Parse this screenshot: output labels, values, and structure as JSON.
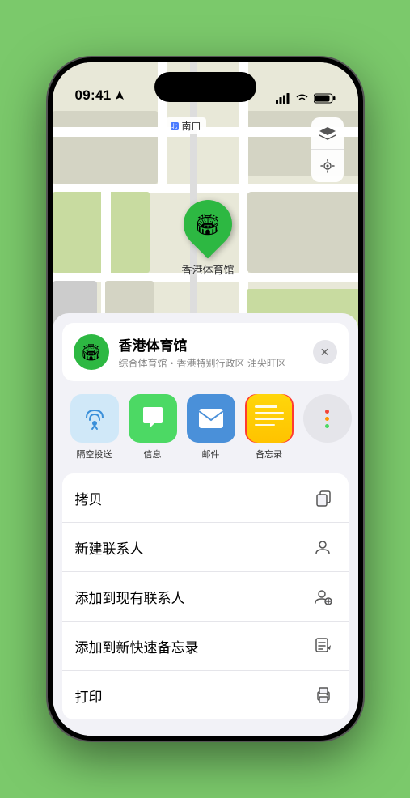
{
  "status_bar": {
    "time": "09:41",
    "location_arrow": "▶"
  },
  "map": {
    "label_text": "南口",
    "controls": [
      "map-layers",
      "location"
    ]
  },
  "marker": {
    "name": "香港体育馆",
    "icon": "🏟"
  },
  "location_card": {
    "name": "香港体育馆",
    "subtitle": "综合体育馆・香港特别行政区 油尖旺区",
    "close_label": "✕"
  },
  "share_items": [
    {
      "id": "airdrop",
      "label": "隔空投送",
      "highlighted": false
    },
    {
      "id": "messages",
      "label": "信息",
      "highlighted": false
    },
    {
      "id": "mail",
      "label": "邮件",
      "highlighted": false
    },
    {
      "id": "notes",
      "label": "备忘录",
      "highlighted": true
    }
  ],
  "more_icon": {
    "dots_colors": [
      "#f44",
      "#f90",
      "#4cd964"
    ]
  },
  "actions": [
    {
      "label": "拷贝",
      "icon": "copy"
    },
    {
      "label": "新建联系人",
      "icon": "person-add"
    },
    {
      "label": "添加到现有联系人",
      "icon": "person-plus"
    },
    {
      "label": "添加到新快速备忘录",
      "icon": "note"
    },
    {
      "label": "打印",
      "icon": "print"
    }
  ]
}
